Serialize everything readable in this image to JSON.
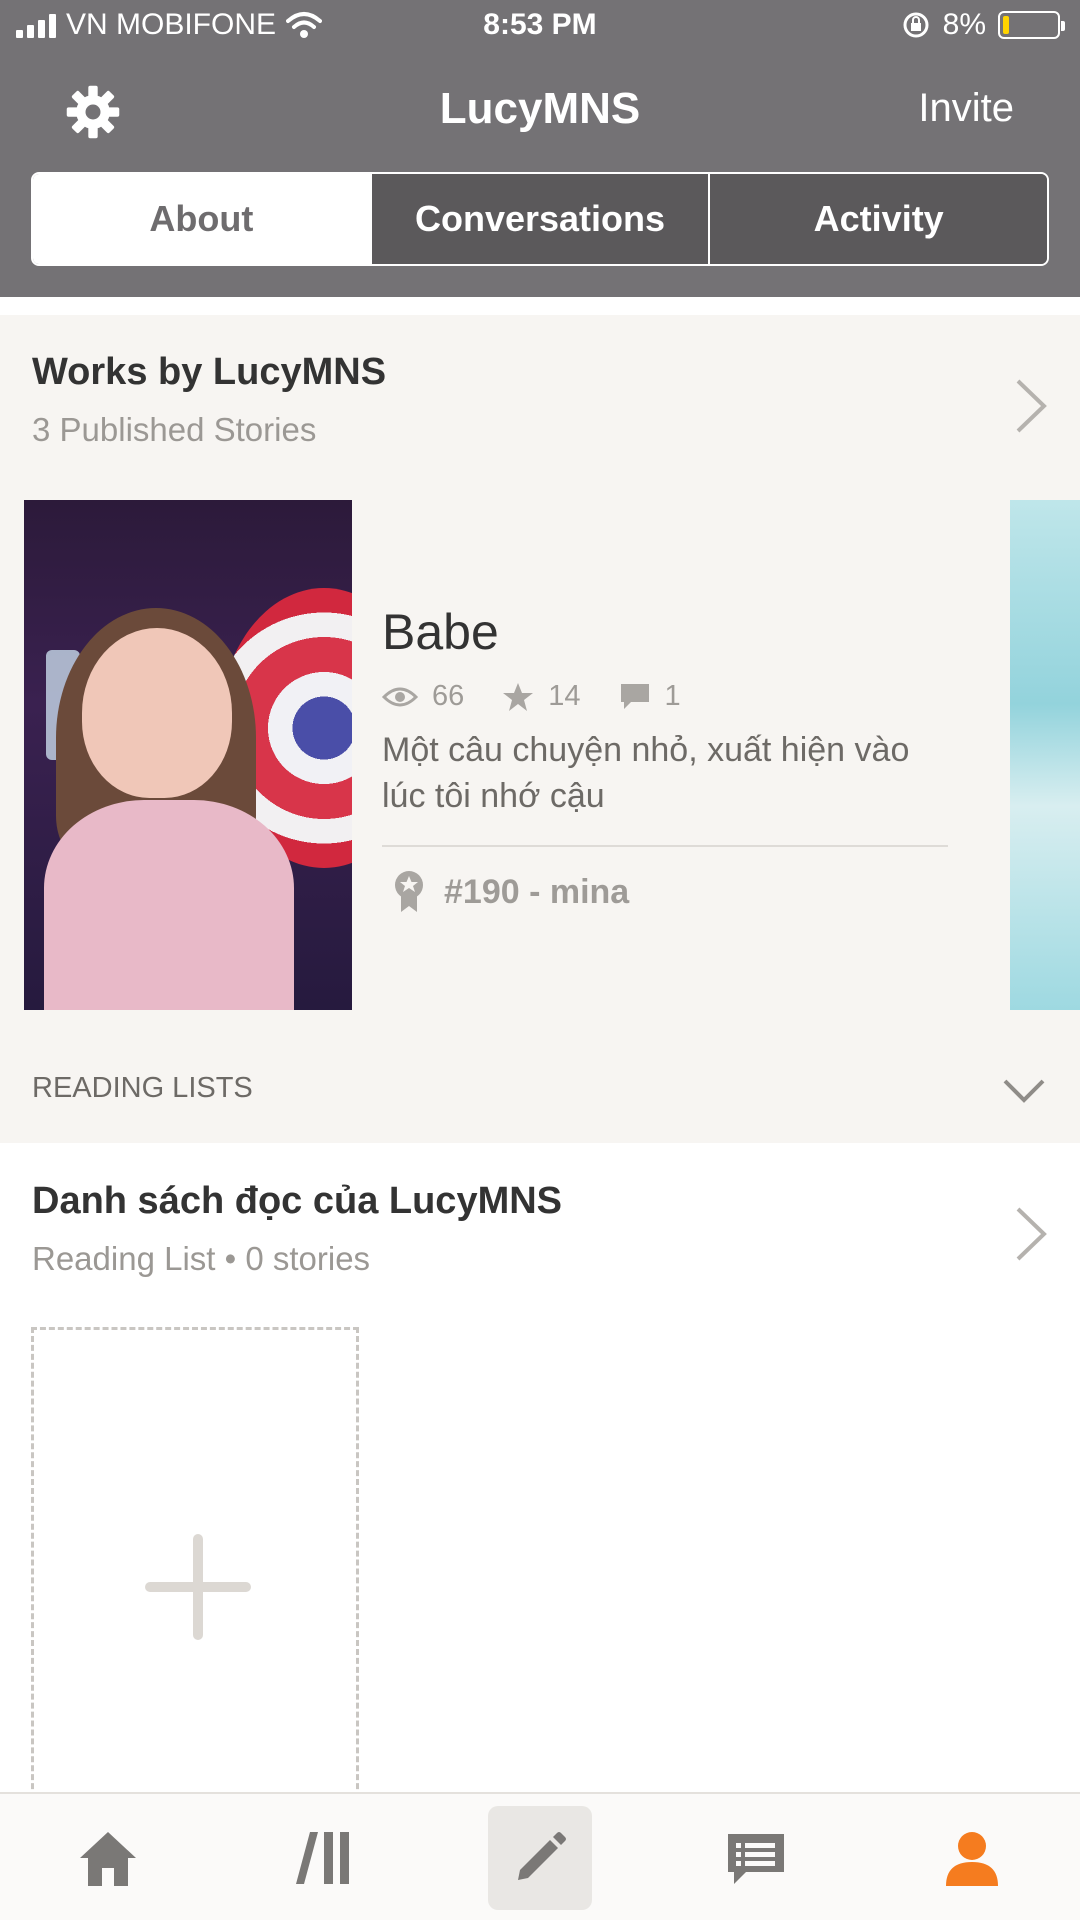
{
  "status_bar": {
    "carrier": "VN MOBIFONE",
    "time": "8:53 PM",
    "battery": "8%",
    "battery_level": 0.08
  },
  "header": {
    "title": "LucyMNS",
    "invite_label": "Invite",
    "settings_icon": "gear-icon"
  },
  "tabs": [
    {
      "label": "About",
      "selected": true
    },
    {
      "label": "Conversations",
      "selected": false
    },
    {
      "label": "Activity",
      "selected": false
    }
  ],
  "works": {
    "title": "Works by LucyMNS",
    "subtitle": "3 Published Stories",
    "story": {
      "title": "Babe",
      "reads": "66",
      "votes": "14",
      "comments": "1",
      "description": "Một câu chuyện nhỏ, xuất hiện vào lúc tôi nhớ cậu",
      "rank": "#190 - mina"
    }
  },
  "reading_lists": {
    "section_label": "READING LISTS",
    "list_title": "Danh sách đọc của LucyMNS",
    "list_sub": "Reading List • 0 stories"
  },
  "tabbar": {
    "items": [
      "home-icon",
      "library-icon",
      "write-icon",
      "messages-icon",
      "profile-icon"
    ],
    "active": "write-icon",
    "accent": "#f57c1f",
    "icon_color": "#7a7876"
  }
}
